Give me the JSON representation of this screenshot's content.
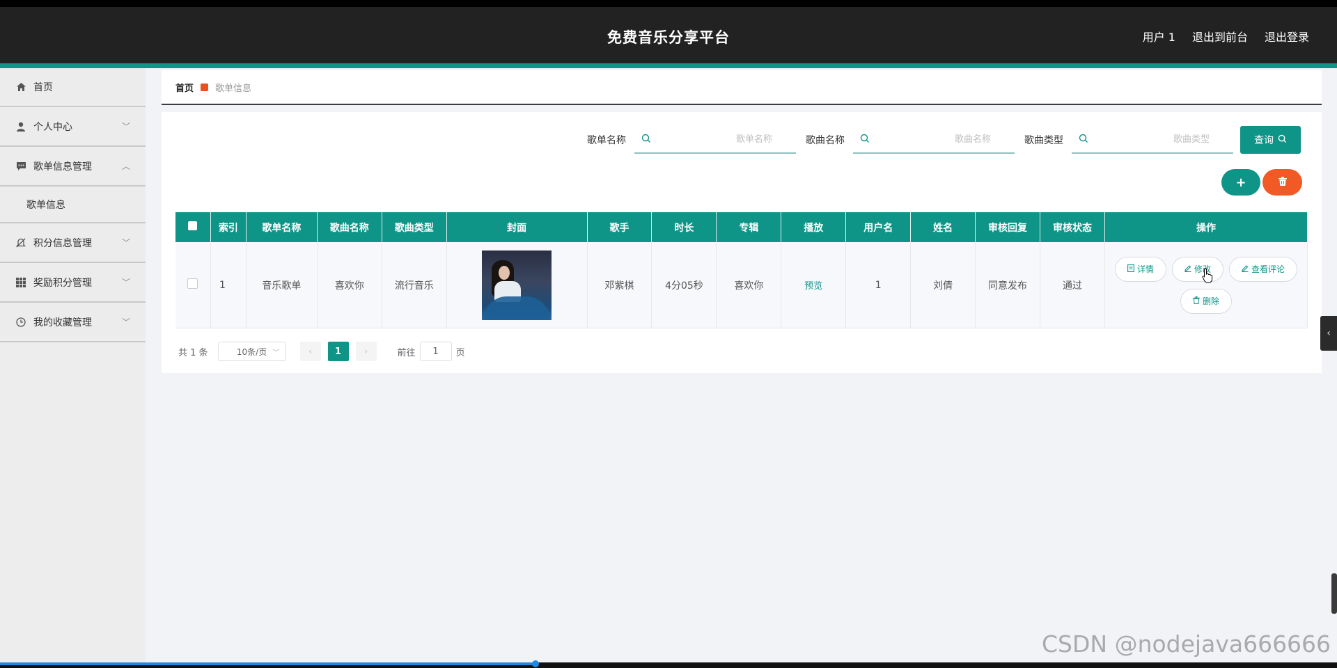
{
  "header": {
    "title": "免费音乐分享平台",
    "links": [
      "用户 1",
      "退出到前台",
      "退出登录"
    ]
  },
  "sidebar": {
    "items": [
      {
        "label": "首页",
        "icon": "home-icon"
      },
      {
        "label": "个人中心",
        "icon": "user-icon"
      },
      {
        "label": "歌单信息管理",
        "icon": "chat-icon",
        "expanded": true
      },
      {
        "label": "积分信息管理",
        "icon": "bell-off-icon"
      },
      {
        "label": "奖励积分管理",
        "icon": "grid-icon"
      },
      {
        "label": "我的收藏管理",
        "icon": "clock-icon"
      }
    ],
    "subitems": [
      {
        "label": "歌单信息"
      }
    ]
  },
  "breadcrumb": {
    "home": "首页",
    "current": "歌单信息"
  },
  "search": {
    "fields": [
      {
        "label": "歌单名称",
        "placeholder": "歌单名称"
      },
      {
        "label": "歌曲名称",
        "placeholder": "歌曲名称"
      },
      {
        "label": "歌曲类型",
        "placeholder": "歌曲类型"
      }
    ],
    "query_label": "查询"
  },
  "actions": {
    "add_symbol": "+"
  },
  "table": {
    "headers": [
      "索引",
      "歌单名称",
      "歌曲名称",
      "歌曲类型",
      "封面",
      "歌手",
      "时长",
      "专辑",
      "播放",
      "用户名",
      "姓名",
      "审核回复",
      "审核状态",
      "操作"
    ],
    "rows": [
      {
        "index": "1",
        "playlist_name": "音乐歌单",
        "song_name": "喜欢你",
        "song_type": "流行音乐",
        "singer": "邓紫棋",
        "duration": "4分05秒",
        "album": "喜欢你",
        "play": "预览",
        "username": "1",
        "name": "刘倩",
        "review_reply": "同意发布",
        "review_status": "通过"
      }
    ],
    "row_actions": {
      "detail": "详情",
      "edit": "修改",
      "comments": "查看评论",
      "delete": "删除"
    }
  },
  "pagination": {
    "total": "共 1 条",
    "page_size": "10条/页",
    "current_page": "1",
    "goto_label": "前往",
    "goto_value": "1",
    "goto_suffix": "页"
  },
  "watermark": "CSDN @nodejava666666",
  "colors": {
    "accent": "#0f9488",
    "danger": "#f15a24",
    "header_bg": "#222222"
  }
}
